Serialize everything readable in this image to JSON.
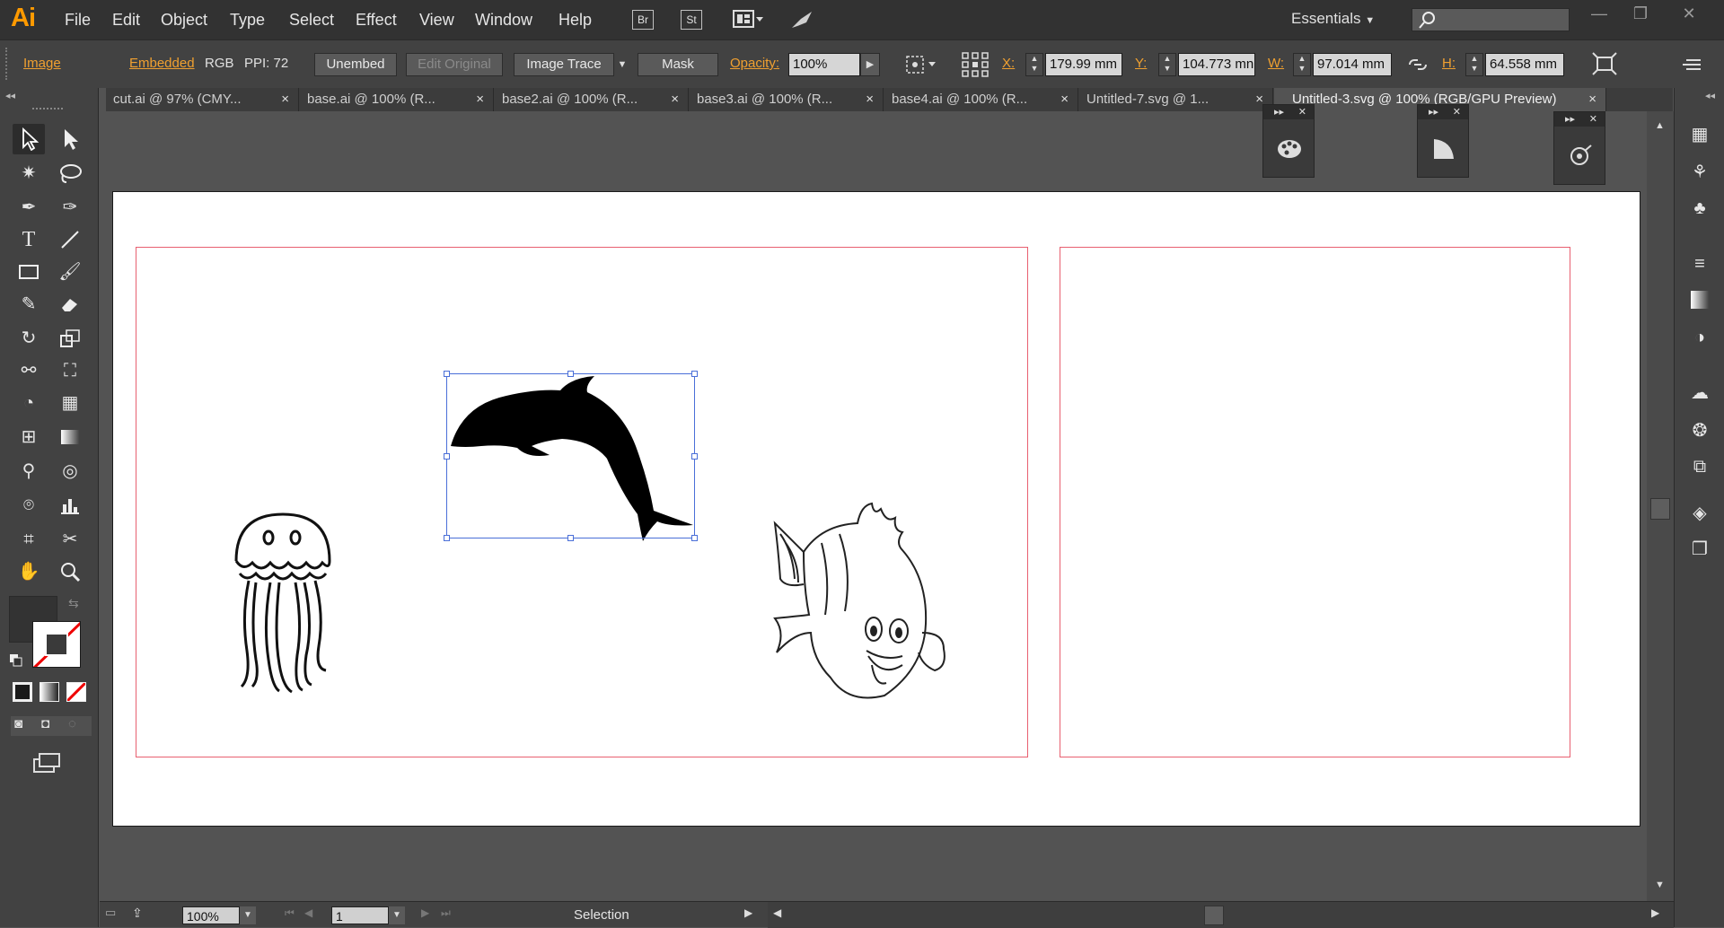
{
  "app": {
    "logo": "Ai"
  },
  "menu": [
    "File",
    "Edit",
    "Object",
    "Type",
    "Select",
    "Effect",
    "View",
    "Window",
    "Help"
  ],
  "menu_buttons": {
    "bridge": "Br",
    "stock": "St"
  },
  "workspace": {
    "label": "Essentials",
    "search_placeholder": ""
  },
  "control": {
    "object_type": "Image",
    "embedded": "Embedded",
    "color_mode": "RGB",
    "ppi": "PPI: 72",
    "unembed": "Unembed",
    "edit_original": "Edit Original",
    "image_trace": "Image Trace",
    "mask": "Mask",
    "opacity_label": "Opacity:",
    "opacity_value": "100%",
    "x_label": "X:",
    "x_value": "179.99 mm",
    "y_label": "Y:",
    "y_value": "104.773 mn",
    "w_label": "W:",
    "w_value": "97.014 mm",
    "h_label": "H:",
    "h_value": "64.558 mm"
  },
  "tabs": [
    {
      "label": "cut.ai @ 97% (CMY..."
    },
    {
      "label": "base.ai @ 100% (R..."
    },
    {
      "label": "base2.ai @ 100% (R..."
    },
    {
      "label": "base3.ai @ 100% (R..."
    },
    {
      "label": "base4.ai @ 100% (R..."
    },
    {
      "label": "Untitled-7.svg @ 1..."
    },
    {
      "label": "Untitled-3.svg @ 100% (RGB/GPU Preview)"
    }
  ],
  "tab_close": "×",
  "status": {
    "zoom": "100%",
    "artboard_number": "1",
    "tool_name": "Selection"
  },
  "colors": {
    "accent_orange": "#f0a030",
    "artboard_border": "#e86070",
    "selection": "#4a6fd8"
  }
}
